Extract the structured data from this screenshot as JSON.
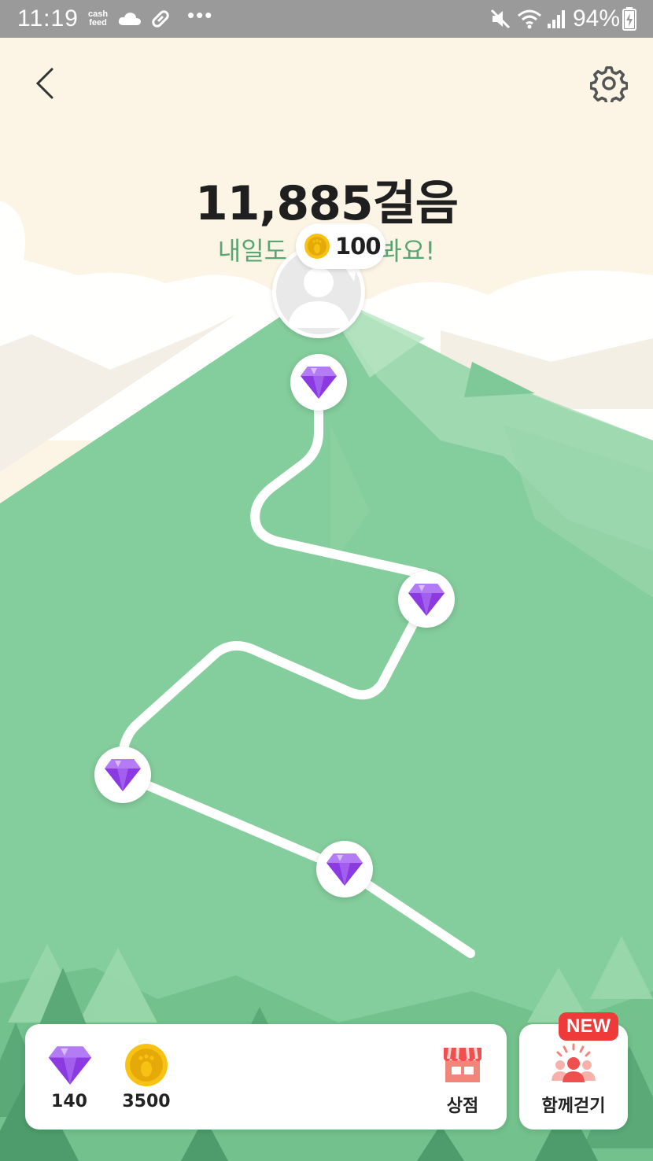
{
  "status_bar": {
    "time": "11:19",
    "cash_top": "cash",
    "cash_bottom": "feed",
    "dots": "•••",
    "battery": "94%"
  },
  "header": {
    "back_icon": "chevron-left-icon",
    "settings_icon": "gear-icon"
  },
  "main": {
    "steps": "11,885걸음",
    "subtitle_left": "내일도 ",
    "subtitle_right": " 봐요!",
    "reward_bubble_value": "100",
    "milestone_icon": "diamond-icon"
  },
  "bottom": {
    "gem_count": "140",
    "coin_count": "3500",
    "shop_label": "상점",
    "walk_together_label": "함께걷기",
    "new_badge": "NEW"
  },
  "colors": {
    "sky": "#fcf4e4",
    "mountain": "#84cd9c",
    "gem": "#8a3ae0",
    "coin": "#f7c211",
    "new_badge": "#ef3a3a",
    "subtitle": "#5aa577"
  }
}
